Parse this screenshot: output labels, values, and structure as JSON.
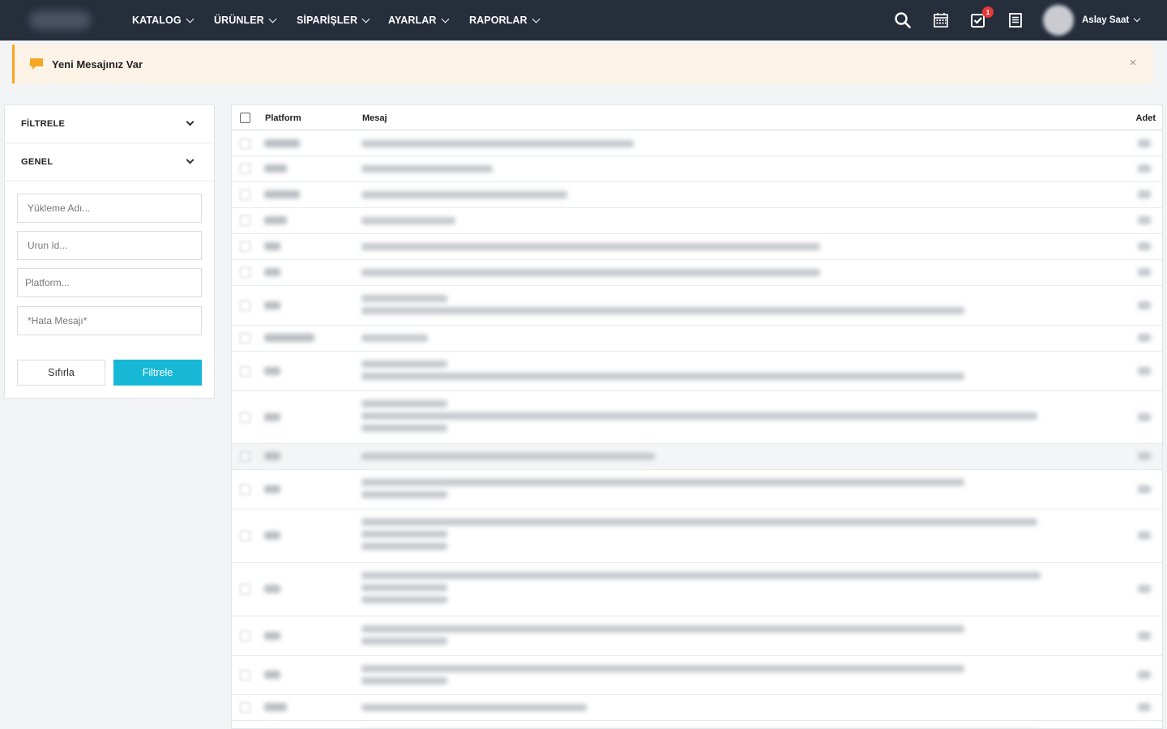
{
  "nav": {
    "items": [
      {
        "label": "KATALOG"
      },
      {
        "label": "ÜRÜNLER"
      },
      {
        "label": "SİPARİŞLER"
      },
      {
        "label": "AYARLAR"
      },
      {
        "label": "RAPORLAR"
      }
    ],
    "notification_count": "1",
    "user_name": "Aslay Saat",
    "icons": [
      "search-icon",
      "calendar-icon",
      "tasks-icon",
      "document-icon"
    ]
  },
  "alert": {
    "message": "Yeni Mesajınız Var",
    "close": "×",
    "accent_color": "#f5a623"
  },
  "filter_panel": {
    "section_filter": "FİLTRELE",
    "section_general": "GENEL",
    "fields": {
      "upload_name_placeholder": "Yükleme Adı...",
      "product_id_placeholder": "Urun Id...",
      "platform_placeholder": "Platform...",
      "error_message_placeholder": "*Hata Mesajı*"
    },
    "reset_label": "Sıfırla",
    "filter_label": "Filtrele",
    "primary_color": "#17b8d6"
  },
  "table": {
    "headers": {
      "platform": "Platform",
      "message": "Mesaj",
      "count": "Adet"
    }
  }
}
